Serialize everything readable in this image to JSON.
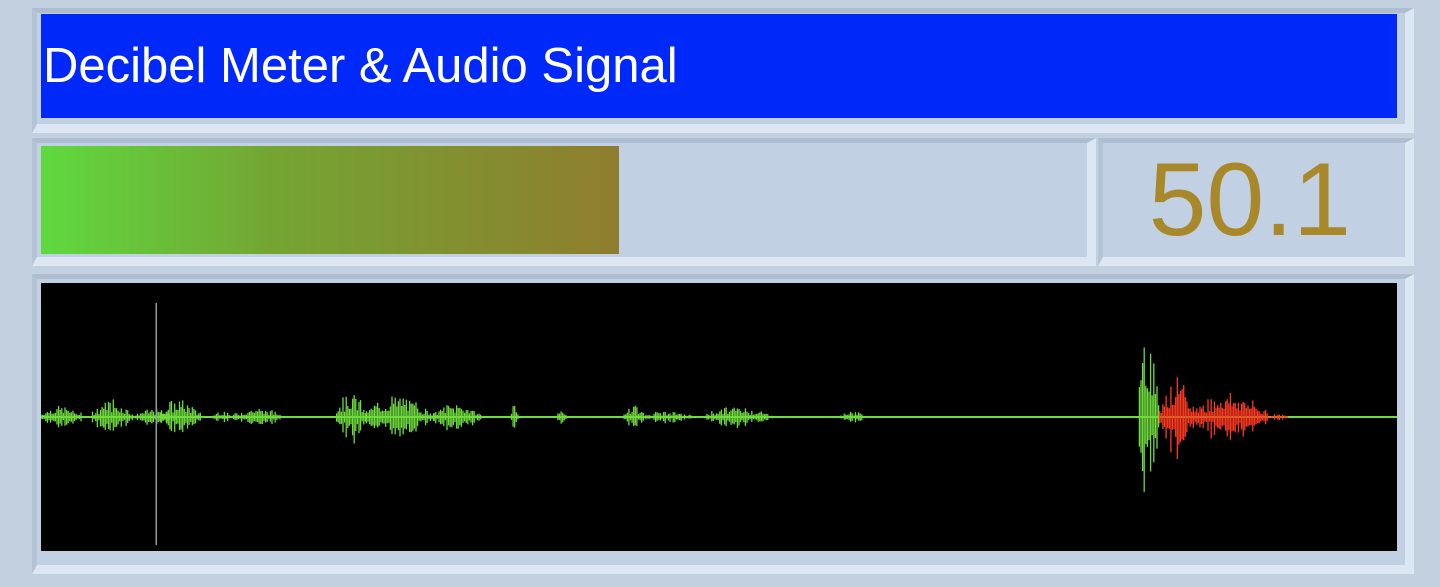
{
  "window": {
    "title": "Decibel Meter & Audio Signal"
  },
  "meter": {
    "level_fraction": 0.555,
    "gradient_colors": [
      "#5fd93f",
      "#74a533",
      "#8f7d2e"
    ]
  },
  "readout": {
    "value": "50.1",
    "color": "#a88828"
  },
  "waveform": {
    "background": "#000000",
    "normal_color": "#6fdc3d",
    "loud_color": "#ff3a20",
    "cursor_color": "#9a9a9a",
    "cursor_position_fraction": 0.085,
    "bursts": [
      {
        "start": 0.0,
        "end": 0.03,
        "amp": 0.1,
        "loud": false
      },
      {
        "start": 0.038,
        "end": 0.068,
        "amp": 0.16,
        "loud": false
      },
      {
        "start": 0.07,
        "end": 0.1,
        "amp": 0.07,
        "loud": false
      },
      {
        "start": 0.088,
        "end": 0.118,
        "amp": 0.15,
        "loud": false
      },
      {
        "start": 0.127,
        "end": 0.14,
        "amp": 0.06,
        "loud": false
      },
      {
        "start": 0.142,
        "end": 0.18,
        "amp": 0.08,
        "loud": false
      },
      {
        "start": 0.218,
        "end": 0.24,
        "amp": 0.23,
        "loud": false
      },
      {
        "start": 0.24,
        "end": 0.29,
        "amp": 0.18,
        "loud": false
      },
      {
        "start": 0.29,
        "end": 0.325,
        "amp": 0.12,
        "loud": false
      },
      {
        "start": 0.347,
        "end": 0.352,
        "amp": 0.14,
        "loud": false
      },
      {
        "start": 0.38,
        "end": 0.388,
        "amp": 0.05,
        "loud": false
      },
      {
        "start": 0.43,
        "end": 0.445,
        "amp": 0.12,
        "loud": false
      },
      {
        "start": 0.445,
        "end": 0.48,
        "amp": 0.05,
        "loud": false
      },
      {
        "start": 0.49,
        "end": 0.54,
        "amp": 0.09,
        "loud": false
      },
      {
        "start": 0.59,
        "end": 0.61,
        "amp": 0.05,
        "loud": false
      },
      {
        "start": 0.81,
        "end": 0.825,
        "amp": 0.72,
        "loud": false
      },
      {
        "start": 0.825,
        "end": 0.85,
        "amp": 0.33,
        "loud": true
      },
      {
        "start": 0.85,
        "end": 0.905,
        "amp": 0.21,
        "loud": true
      },
      {
        "start": 0.905,
        "end": 0.92,
        "amp": 0.03,
        "loud": true
      }
    ]
  }
}
